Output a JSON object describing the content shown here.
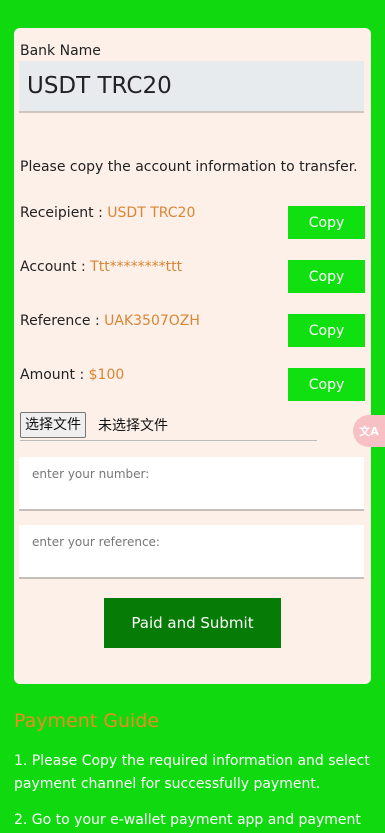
{
  "form": {
    "bank_label": "Bank Name",
    "bank_value": "USDT TRC20",
    "instruction": "Please copy the account information to transfer.",
    "rows": [
      {
        "label": "Receipient : ",
        "value": "USDT TRC20",
        "button": "Copy"
      },
      {
        "label": "Account : ",
        "value": "Ttt********ttt",
        "button": "Copy"
      },
      {
        "label": "Reference : ",
        "value": "UAK3507OZH",
        "button": "Copy"
      },
      {
        "label": "Amount : ",
        "value": "$100",
        "button": "Copy"
      }
    ],
    "file_button": "选择文件",
    "file_status": "未选择文件",
    "number_placeholder": "enter your number:",
    "reference_placeholder": "enter your reference:",
    "submit_label": "Paid and Submit"
  },
  "guide": {
    "title": "Payment Guide",
    "items": [
      "1. Please Copy the required information and select payment channel for successfully payment.",
      "2. Go to your e-wallet payment app and payment"
    ]
  },
  "floating_button": {
    "icon": "translate-icon",
    "text": "文A"
  },
  "colors": {
    "page_bg": "#10d910",
    "card_bg": "#fdf0e8",
    "accent_value": "#d98535",
    "copy_button": "#10e010",
    "submit_button": "#067c06",
    "guide_title": "#ea8d1f"
  }
}
